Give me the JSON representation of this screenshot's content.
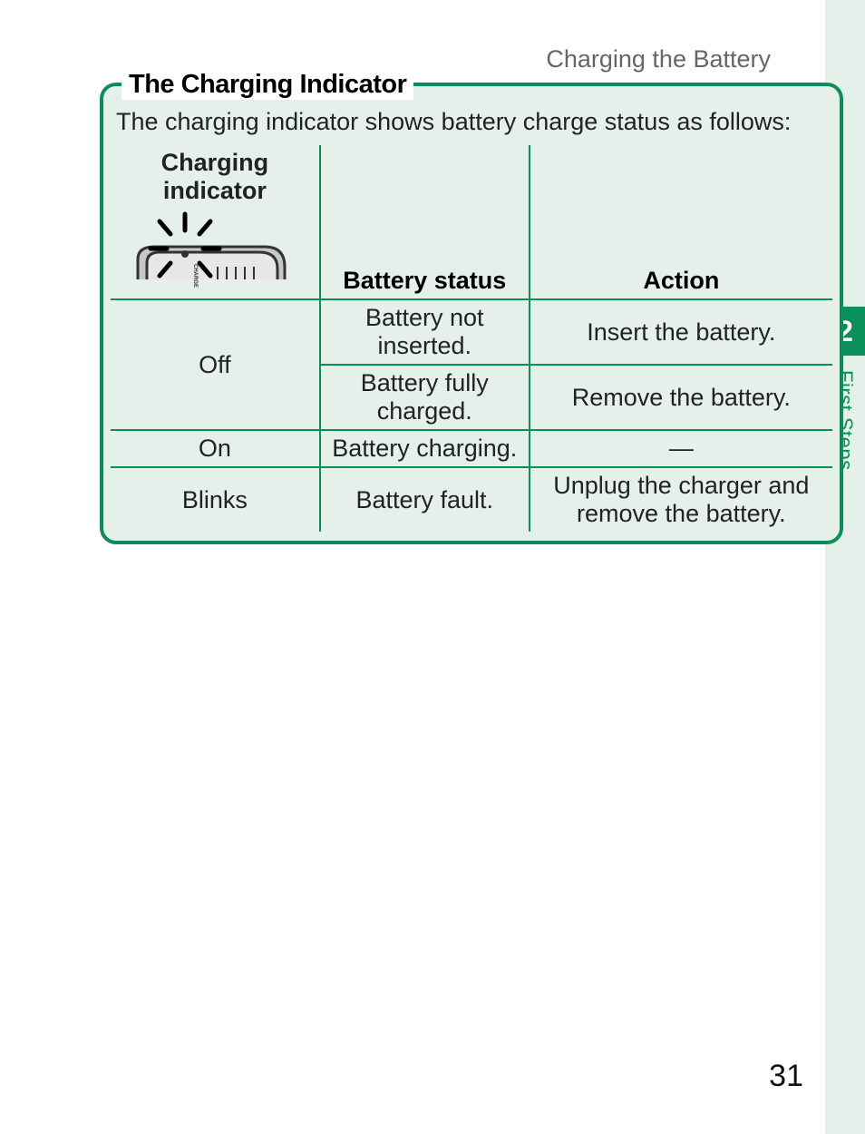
{
  "header": {
    "title": "Charging the Battery"
  },
  "side": {
    "chapter_number": "2",
    "chapter_label": "First Steps"
  },
  "callout": {
    "title": "The Charging Indicator",
    "intro": "The charging indicator shows battery charge status as follows:",
    "columns": {
      "col1": "Charging indicator",
      "col2": "Battery status",
      "col3": "Action"
    },
    "rows": [
      {
        "indicator": "Off",
        "status": "Battery not inserted.",
        "action": "Insert the battery."
      },
      {
        "indicator": "Off",
        "status": "Battery fully charged.",
        "action": "Remove the battery."
      },
      {
        "indicator": "On",
        "status": "Battery charging.",
        "action": "—"
      },
      {
        "indicator": "Blinks",
        "status": "Battery fault.",
        "action": "Unplug the charger and remove the battery."
      }
    ]
  },
  "icons": {
    "charger_label": "CHARGE"
  },
  "page_number": "31"
}
